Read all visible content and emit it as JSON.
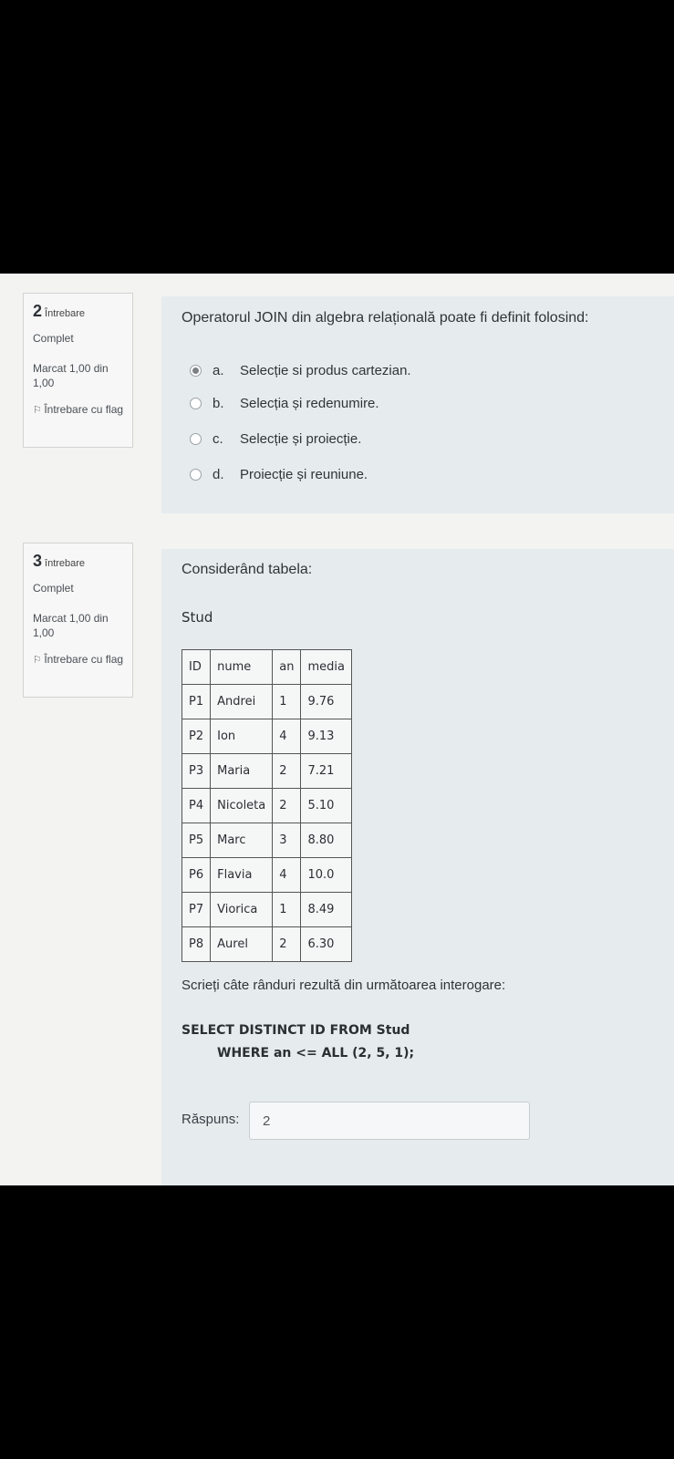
{
  "q2": {
    "number": "2",
    "word": "Întrebare",
    "state": "Complet",
    "grade": "Marcat 1,00 din 1,00",
    "flag_label": "Întrebare cu flag",
    "text": "Operatorul JOIN din algebra relațională poate fi definit folosind:",
    "options": [
      {
        "letter": "a.",
        "label": "Selecție si produs cartezian.",
        "checked": true
      },
      {
        "letter": "b.",
        "label": "Selecția și redenumire.",
        "checked": false
      },
      {
        "letter": "c.",
        "label": "Selecție și proiecție.",
        "checked": false
      },
      {
        "letter": "d.",
        "label": "Proiecție și reuniune.",
        "checked": false
      }
    ]
  },
  "q3": {
    "number": "3",
    "word": "întrebare",
    "state": "Complet",
    "grade": "Marcat 1,00 din 1,00",
    "flag_label": "Întrebare cu flag",
    "intro": "Considerând tabela:",
    "table_name": "Stud",
    "headers": [
      "ID",
      "nume",
      "an",
      "media"
    ],
    "rows": [
      [
        "P1",
        "Andrei",
        "1",
        "9.76"
      ],
      [
        "P2",
        "Ion",
        "4",
        "9.13"
      ],
      [
        "P3",
        "Maria",
        "2",
        "7.21"
      ],
      [
        "P4",
        "Nicoleta",
        "2",
        "5.10"
      ],
      [
        "P5",
        "Marc",
        "3",
        "8.80"
      ],
      [
        "P6",
        "Flavia",
        "4",
        "10.0"
      ],
      [
        "P7",
        "Viorica",
        "1",
        "8.49"
      ],
      [
        "P8",
        "Aurel",
        "2",
        "6.30"
      ]
    ],
    "prompt": "Scrieți câte rânduri rezultă din următoarea interogare:",
    "sql_line1": "SELECT DISTINCT ID FROM Stud",
    "sql_line2": "WHERE an <= ALL (2, 5, 1);",
    "answer_label": "Răspuns:",
    "answer_value": "2"
  }
}
